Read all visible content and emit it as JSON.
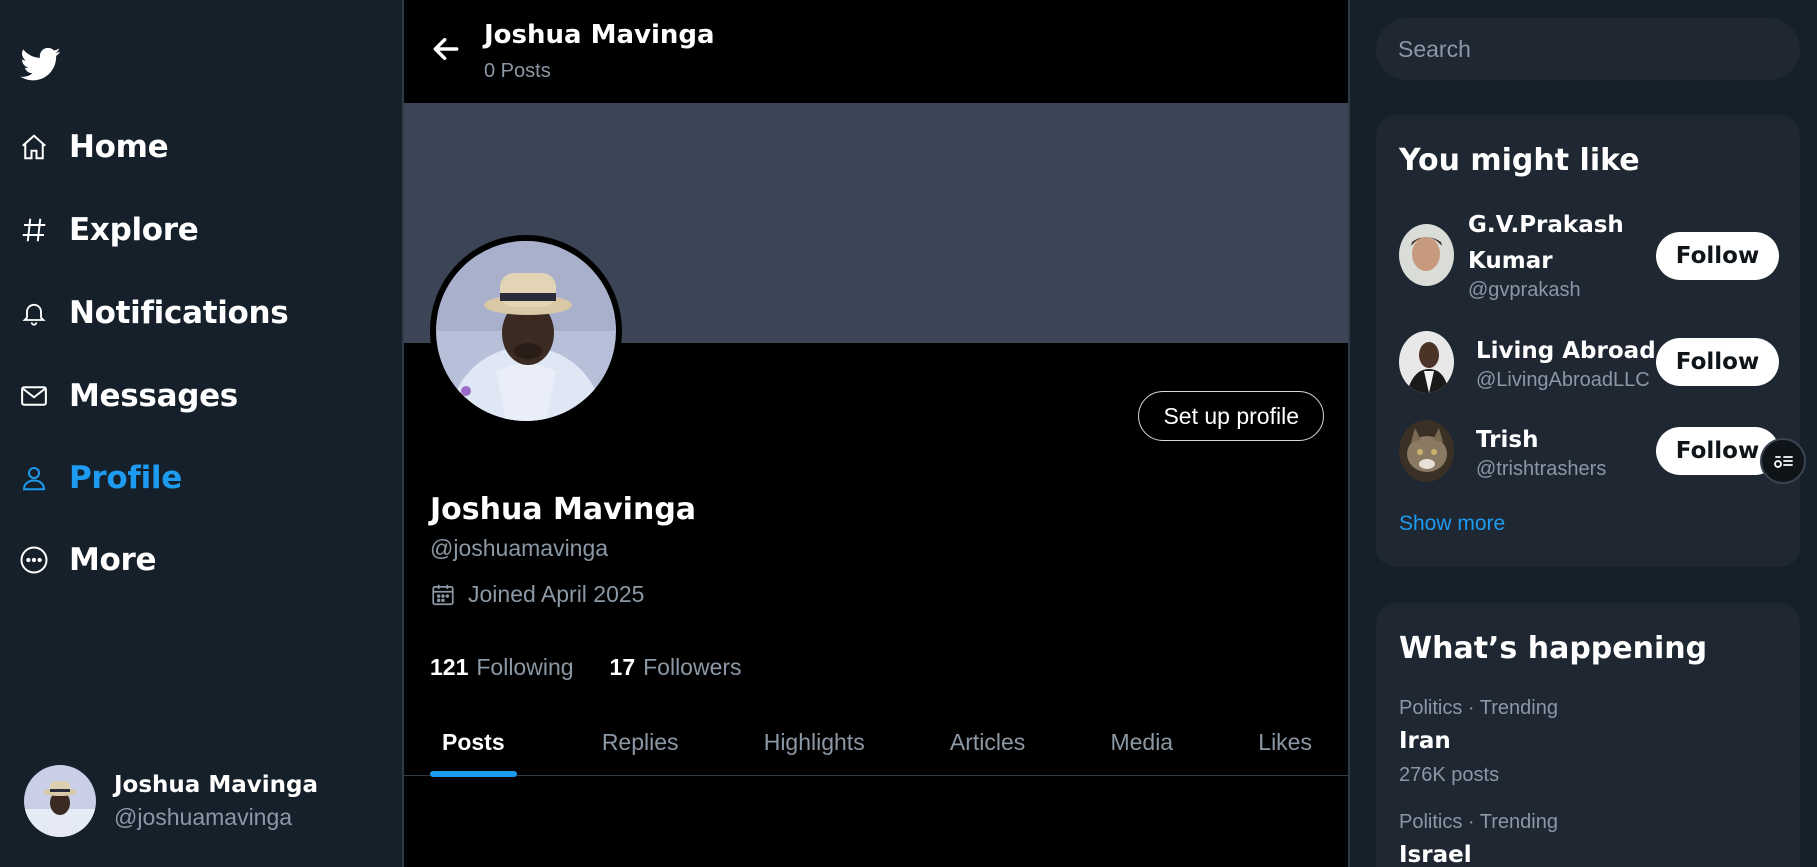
{
  "nav": {
    "items": [
      {
        "label": "Home",
        "icon": "home-icon"
      },
      {
        "label": "Explore",
        "icon": "hash-icon"
      },
      {
        "label": "Notifications",
        "icon": "bell-icon"
      },
      {
        "label": "Messages",
        "icon": "mail-icon"
      },
      {
        "label": "Profile",
        "icon": "user-icon",
        "active": true
      },
      {
        "label": "More",
        "icon": "more-circle-icon"
      }
    ]
  },
  "account": {
    "name": "Joshua Mavinga",
    "handle": "@joshuamavinga"
  },
  "header": {
    "name": "Joshua Mavinga",
    "posts": "0 Posts"
  },
  "profile": {
    "name": "Joshua Mavinga",
    "handle": "@joshuamavinga",
    "joined": "Joined April 2025",
    "setup_label": "Set up profile",
    "following_count": "121",
    "following_label": "Following",
    "followers_count": "17",
    "followers_label": "Followers"
  },
  "tabs": [
    {
      "label": "Posts",
      "active": true
    },
    {
      "label": "Replies"
    },
    {
      "label": "Highlights"
    },
    {
      "label": "Articles"
    },
    {
      "label": "Media"
    },
    {
      "label": "Likes"
    }
  ],
  "search": {
    "placeholder": "Search"
  },
  "who_to_follow": {
    "title": "You might like",
    "users": [
      {
        "name_line1": "G.V.Prakash",
        "name_line2": "Kumar",
        "handle": "@gvprakash",
        "button": "Follow"
      },
      {
        "name": "Living Abroad",
        "handle": "@LivingAbroadLLC",
        "button": "Follow"
      },
      {
        "name": "Trish",
        "handle": "@trishtrashers",
        "button": "Follow"
      }
    ],
    "show_more": "Show more"
  },
  "trends": {
    "title": "What’s happening",
    "items": [
      {
        "meta": "Politics · Trending",
        "title": "Iran",
        "count": "276K posts"
      },
      {
        "meta": "Politics · Trending",
        "title": "Israel"
      }
    ]
  },
  "colors": {
    "accent": "#1d9bf0",
    "bg": "#15202b",
    "panel": "#1e2732",
    "muted": "#8b98a5"
  }
}
